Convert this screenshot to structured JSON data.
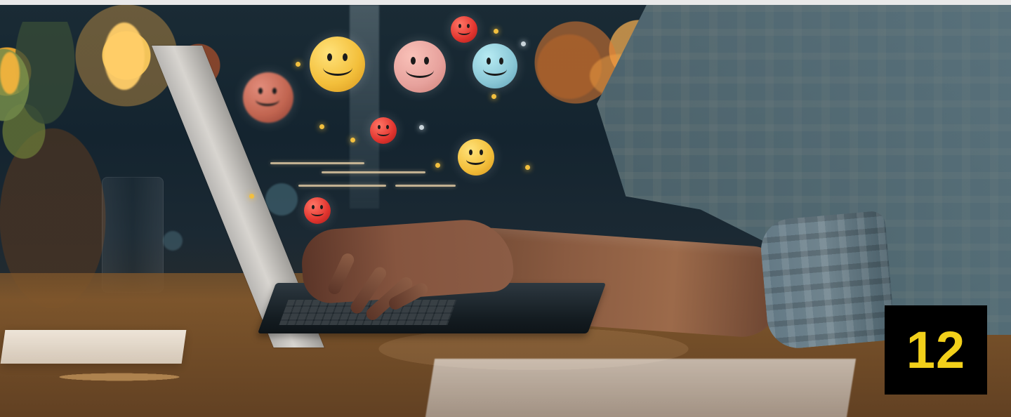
{
  "badge": {
    "number": "12"
  },
  "scene": {
    "colors": {
      "badge_background": "#000000",
      "badge_text": "#f2d01a",
      "yellow_emoji": "#f3bf3b",
      "pink_emoji": "#e7a29d",
      "blue_emoji": "#8ac7d6",
      "red_emoji": "#e2352f",
      "orange_emoji": "#d96e55"
    },
    "icons": [
      "yellow-smile-icon",
      "pink-smile-icon",
      "blue-smile-icon",
      "red-smile-icon",
      "orange-smile-icon"
    ]
  }
}
